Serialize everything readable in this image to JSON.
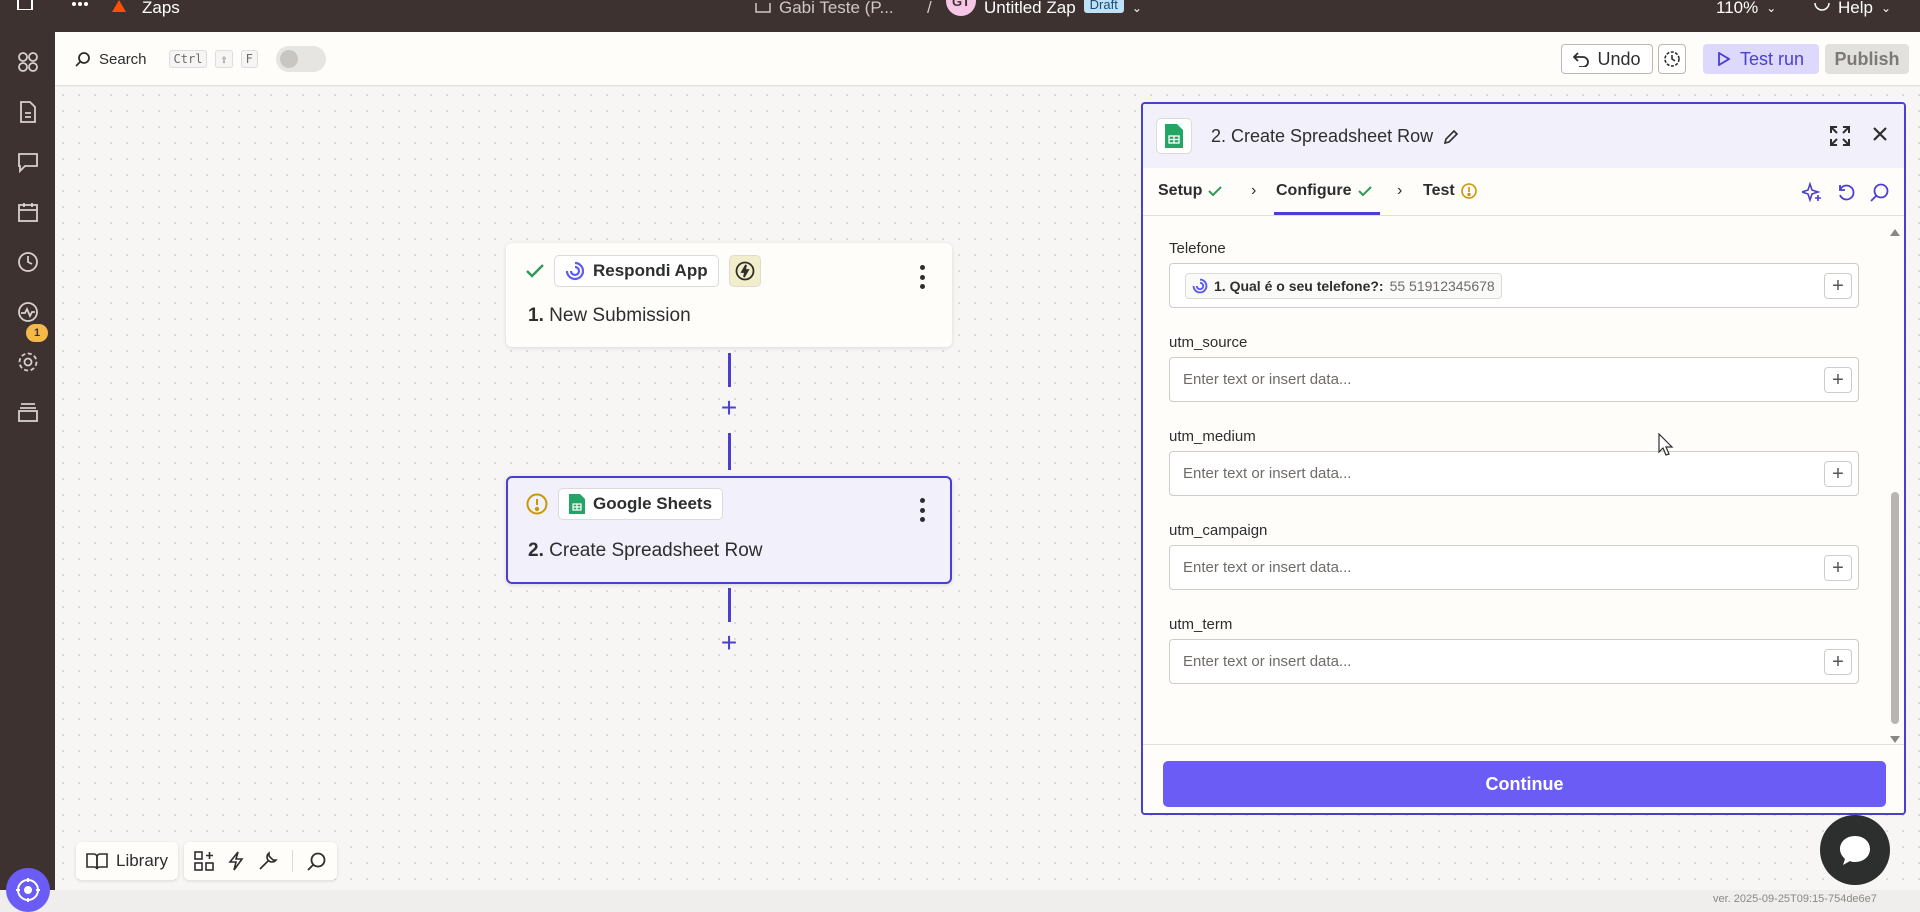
{
  "topbar": {
    "app_name": "Zaps",
    "folder": "Gabi Teste (P...",
    "separator": "/",
    "user_initials": "GT",
    "zap_name": "Untitled Zap",
    "status_badge": "Draft",
    "zoom": "110%",
    "help": "Help"
  },
  "sidebar": {
    "notifications_count": "1"
  },
  "toolbar": {
    "search_label": "Search",
    "shortcut_ctrl": "Ctrl",
    "shortcut_shift": "⇧",
    "shortcut_key": "F",
    "undo_label": "Undo",
    "test_run_label": "Test run",
    "publish_label": "Publish"
  },
  "canvas": {
    "steps": [
      {
        "app": "Respondi App",
        "number": "1.",
        "title": "New Submission"
      },
      {
        "app": "Google Sheets",
        "number": "2.",
        "title": "Create Spreadsheet Row"
      }
    ]
  },
  "library": {
    "label": "Library"
  },
  "panel": {
    "title": "2. Create Spreadsheet Row",
    "tabs": {
      "setup": "Setup",
      "configure": "Configure",
      "test": "Test"
    },
    "fields": [
      {
        "label": "Telefone",
        "pill_label": "1. Qual é o seu telefone?:",
        "pill_value": "55 51912345678"
      },
      {
        "label": "utm_source",
        "placeholder": "Enter text or insert data..."
      },
      {
        "label": "utm_medium",
        "placeholder": "Enter text or insert data..."
      },
      {
        "label": "utm_campaign",
        "placeholder": "Enter text or insert data..."
      },
      {
        "label": "utm_term",
        "placeholder": "Enter text or insert data..."
      }
    ],
    "continue_label": "Continue"
  },
  "version": "ver. 2025-09-25T09:15-754de6e7",
  "colors": {
    "accent": "#4a3fd0",
    "primary_button": "#6b5cf6",
    "sidebar": "#3d3230",
    "success": "#2e9a5a",
    "warning": "#c99700"
  }
}
